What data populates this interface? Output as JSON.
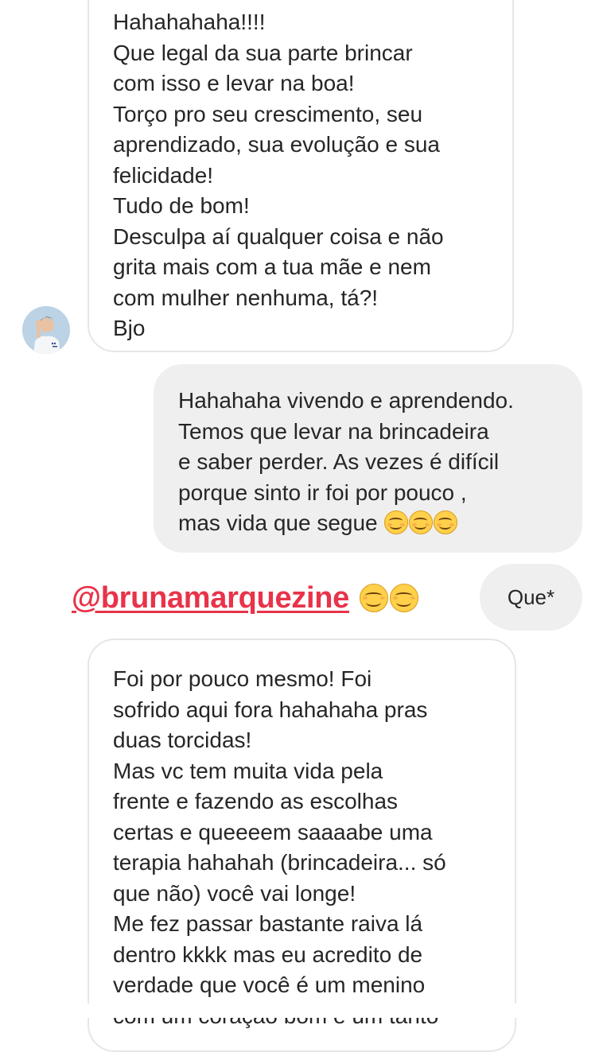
{
  "messages": {
    "first_received": {
      "lines": [
        "Hahahahaha!!!!",
        "Que legal da sua parte brincar",
        "com isso e levar na boa!",
        "Torço pro seu crescimento, seu",
        "aprendizado, sua evolução e sua",
        "felicidade!",
        "Tudo de bom!",
        "Desculpa aí qualquer coisa e não",
        "grita mais com a tua mãe e nem",
        "com mulher nenhuma, tá?!",
        "Bjo"
      ]
    },
    "sent": {
      "lines": [
        "Hahahaha vivendo e aprendendo.",
        "Temos que levar na brincadeira",
        "e saber perder. As vezes é difícil",
        "porque sinto ir foi por pouco ,",
        "mas vida que segue "
      ]
    },
    "correction": {
      "text": "Que*"
    },
    "second_received": {
      "lines": [
        "Foi por pouco mesmo! Foi",
        "sofrido aqui fora hahahaha pras",
        "duas torcidas!",
        "Mas vc tem muita vida pela",
        "frente e fazendo as escolhas",
        "certas e queeeem saaaabe uma",
        "terapia hahahah (brincadeira... só",
        "que não) você vai longe!",
        "Me fez passar bastante raiva lá",
        "dentro kkkk mas eu acredito de",
        "verdade que você é um menino",
        "com um coração bom e um tanto"
      ]
    }
  },
  "mention": {
    "handle": "@brunamarquezine"
  },
  "emoji": {
    "name": "smiling-face-with-smiling-eyes"
  },
  "colors": {
    "mention": "#e8334a",
    "sent_bubble": "#efefef",
    "received_border": "#e6e6e6",
    "text": "#262626"
  }
}
